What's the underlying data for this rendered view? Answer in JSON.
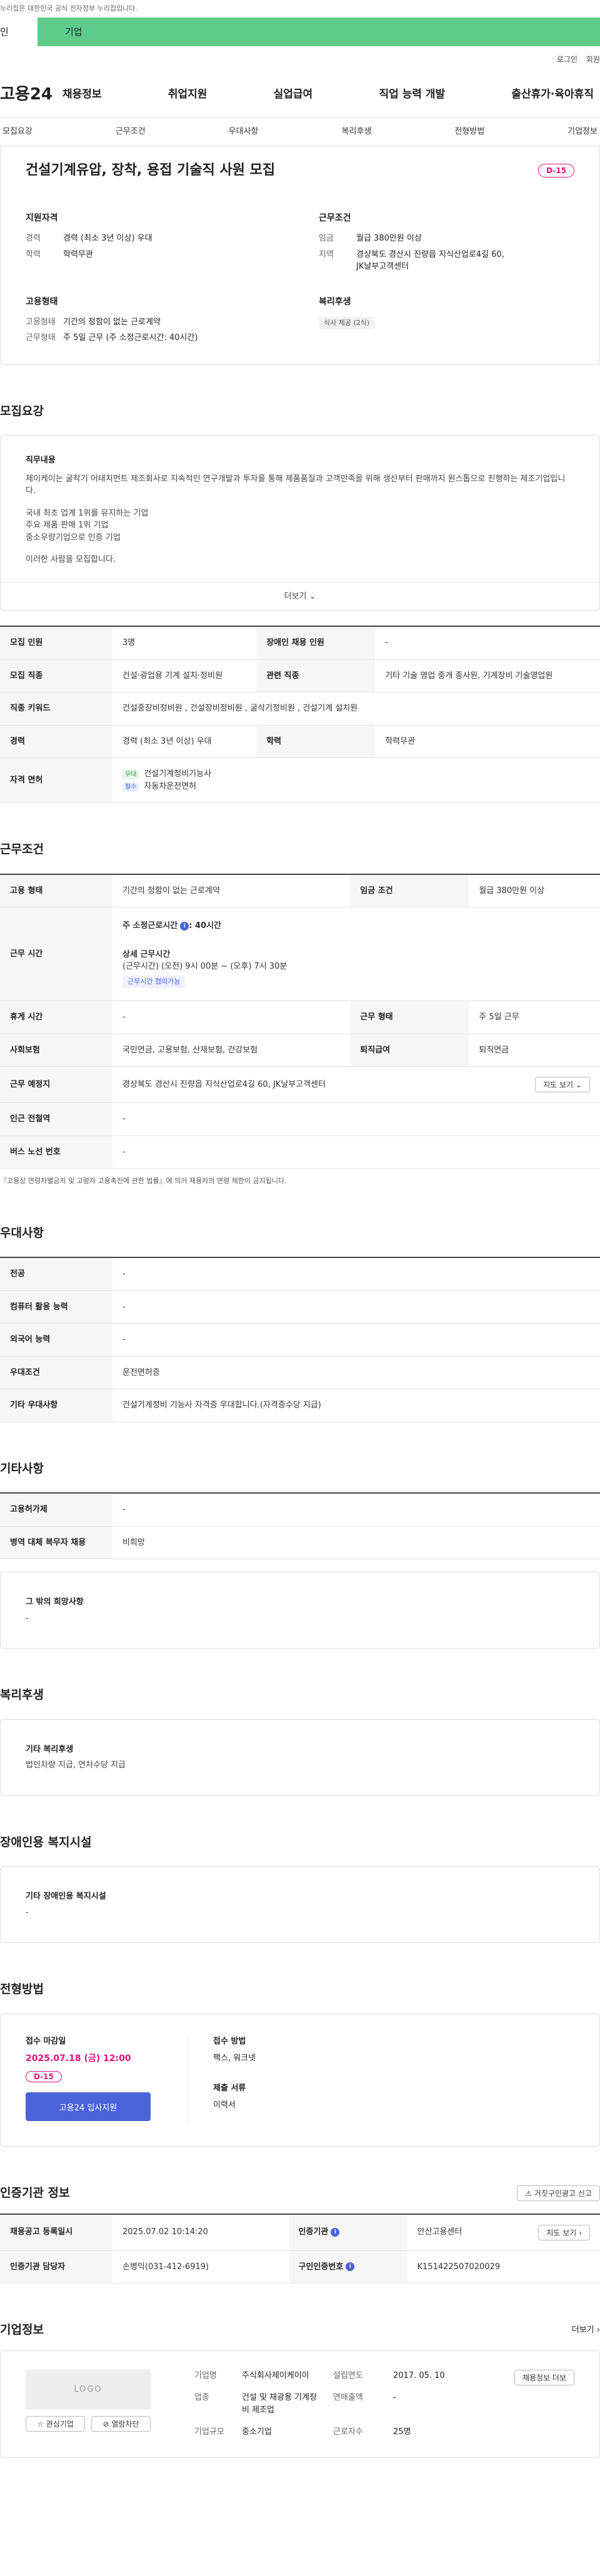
{
  "gov_notice": "누리집은 대한민국 공식 전자정부 누리집입니다.",
  "role_tabs": {
    "person": "인",
    "company": "기업"
  },
  "util": {
    "login": "로그인",
    "join": "회원"
  },
  "brand": "고용24",
  "gnb": [
    "채용정보",
    "취업지원",
    "실업급여",
    "직업 능력 개발",
    "출산휴가·육아휴직"
  ],
  "anchor_tabs": [
    "모집요강",
    "근무조건",
    "우대사항",
    "복리후생",
    "전형방법",
    "기업정보"
  ],
  "job": {
    "title": "건설기계유압, 장착, 용접 기술직 사원 모집",
    "dday": "D-15",
    "qual_title": "지원자격",
    "career_k": "경력",
    "career_v": "경력 (최소 3년 이상) 우대",
    "edu_k": "학력",
    "edu_v": "학력무관",
    "cond_title": "근무조건",
    "wage_k": "임금",
    "wage_v": "월급 380만원 이상",
    "loc_k": "지역",
    "loc_v": "경상북도 경산시 진량읍 지식산업로4길 60, JK날부고객센터",
    "emp_title": "고용형태",
    "emp_k": "고용형태",
    "emp_v": "기간의 정함이 없는 근로계약",
    "work_k": "근무형태",
    "work_v": "주 5일 근무 (주 소정근로시간: 40시간)",
    "welfare_title": "복리후생",
    "welfare_chip": "식사 제공 (2식)"
  },
  "recruit": {
    "heading": "모집요강",
    "duty_label": "직무내용",
    "desc1": "제이케이는 굴착기 어태치먼트 제조회사로 지속적인 연구개발과 투자를 통해 제품품질과 고객만족을 위해 생산부터 판매까지 원스톱으로 진행하는 제조기업입니다.",
    "desc2": "국내 최초 업계 1위를 유지하는 기업",
    "desc3": "주요 제품 판매 1위 기업",
    "desc4": "중소우량기업으로 인증 기업",
    "desc5": "이러한 사람을 모집합니다.",
    "more": "더보기",
    "table": {
      "hire_count_k": "모집 인원",
      "hire_count_v": "3명",
      "disabled_k": "장애인 채용 인원",
      "disabled_v": "-",
      "job_k": "모집 직종",
      "job_v": "건설·광업용 기계 설치·정비원",
      "related_k": "관련 직종",
      "related_v": "기타 기술 영업 중개 종사원, 기계장비 기술영업원",
      "keyword_k": "직종 키워드",
      "keyword_v": "건설중장비정비원 , 건설장비정비원 , 굴삭기정비원 , 건설기계 설치원",
      "career_k": "경력",
      "career_v": "경력 (최소 3년 이상) 우대",
      "edu_k": "학력",
      "edu_v": "학력무관",
      "license_k": "자격 면허",
      "license1_tag": "우대",
      "license1": "건설기계정비기능사",
      "license2_tag": "필수",
      "license2": "자동차운전면허"
    }
  },
  "work": {
    "heading": "근무조건",
    "type_k": "고용 형태",
    "type_v": "기간의 정함이 없는 근로계약",
    "wage_k": "임금 조건",
    "wage_v": "월급 380만원 이상",
    "hours_k": "근무 시간",
    "hours_main": "주 소정근로시간",
    "hours_main_v": ": 40시간",
    "hours_detail_label": "상세 근무시간",
    "hours_detail": "(근무시간) (오전) 9시 00분 ~ (오후) 7시 30분",
    "hours_chip": "근무시간 협의가능",
    "rest_k": "휴게 시간",
    "rest_v": "-",
    "form_k": "근무 형태",
    "form_v": "주 5일 근무",
    "ins_k": "사회보험",
    "ins_v": "국민연금, 고용보험, 산재보험, 건강보험",
    "retire_k": "퇴직급여",
    "retire_v": "퇴직연금",
    "place_k": "근무 예정지",
    "place_v": "경상북도 경산시 진량읍 지식산업로4길 60, JK날부고객센터",
    "map_btn": "지도 보기",
    "subway_k": "인근 전철역",
    "subway_v": "-",
    "bus_k": "버스 노선 번호",
    "bus_v": "-",
    "note": "『고용상 연령차별금지 및 고령자 고용촉진에 관한 법률』에 의거 채용자의 연령 제한이 금지됩니다."
  },
  "pref": {
    "heading": "우대사항",
    "major_k": "전공",
    "major_v": "-",
    "pc_k": "컴퓨터 활용 능력",
    "pc_v": "-",
    "lang_k": "외국어 능력",
    "lang_v": "-",
    "cond_k": "우대조건",
    "cond_v": "운전면허증",
    "etc_k": "기타 우대사항",
    "etc_v": "건설기계정비 기능사 자격증 우대합니다.(자격증수당 지급)"
  },
  "other": {
    "heading": "기타사항",
    "emp_k": "고용허가제",
    "emp_v": "-",
    "mil_k": "병역 대체 복무자 채용",
    "mil_v": "비희망",
    "wish_label": "그 밖의 희망사항",
    "wish_v": "-"
  },
  "welfare": {
    "heading": "복리후생",
    "label": "기타 복리후생",
    "value": "법인차량 지급, 연차수당 지급"
  },
  "disabled_fac": {
    "heading": "장애인용 복지시설",
    "label": "기타 장애인용 복지시설",
    "value": "-"
  },
  "apply": {
    "heading": "전형방법",
    "deadline_label": "접수 마감일",
    "deadline": "2025.07.18 (금) 12:00",
    "dday": "D-15",
    "apply_btn": "고용24 입사지원",
    "method_label": "접수 방법",
    "method_v": "팩스, 워크넷",
    "docs_label": "제출 서류",
    "docs_v": "이력서"
  },
  "cert": {
    "heading": "인증기관 정보",
    "report_btn": "거짓구인광고 신고",
    "reg_k": "채용공고 등록일시",
    "reg_v": "2025.07.02 10:14:20",
    "org_k": "인증기관",
    "org_v": "안산고용센터",
    "map_btn": "지도 보기",
    "person_k": "인증기관 담당자",
    "person_v": "손병익(031-412-6919)",
    "no_k": "구인인증번호",
    "no_v": "K151422507020029"
  },
  "company": {
    "heading": "기업정보",
    "more": "더보기",
    "logo": "LOGO",
    "interest_btn": "관심기업",
    "block_btn": "열람차단",
    "name_k": "기업명",
    "name_v": "주식회사제이케이이",
    "year_k": "설립연도",
    "year_v": "2017. 05. 10",
    "ind_k": "업종",
    "ind_v": "건설 및 채광용 기계장비 제조업",
    "sales_k": "연매출액",
    "sales_v": "-",
    "staff_k": "근로자수",
    "staff_v": "25명",
    "size_k": "기업규모",
    "size_v": "중소기업",
    "detail_btn": "채용정보 더보"
  }
}
